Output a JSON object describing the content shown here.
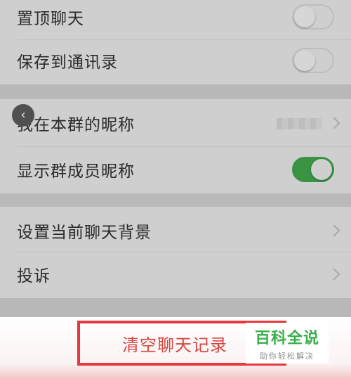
{
  "settings": {
    "pin_chat": {
      "label": "置顶聊天",
      "enabled": false
    },
    "save_to_contacts": {
      "label": "保存到通讯录",
      "enabled": false
    },
    "my_group_nickname": {
      "label": "我在本群的昵称"
    },
    "show_member_nicknames": {
      "label": "显示群成员昵称",
      "enabled": true
    },
    "set_chat_background": {
      "label": "设置当前聊天背景"
    },
    "report": {
      "label": "投诉"
    }
  },
  "actions": {
    "clear_history_label": "清空聊天记录"
  },
  "watermark": {
    "title": "百科全说",
    "subtitle": "助你轻松解决"
  },
  "icons": {
    "back": "back-chevron-icon",
    "nav_arrow": "chevron-right-icon"
  },
  "colors": {
    "toggle_on": "#3a9243",
    "danger": "#e6383e",
    "brand_green": "#38b049"
  }
}
